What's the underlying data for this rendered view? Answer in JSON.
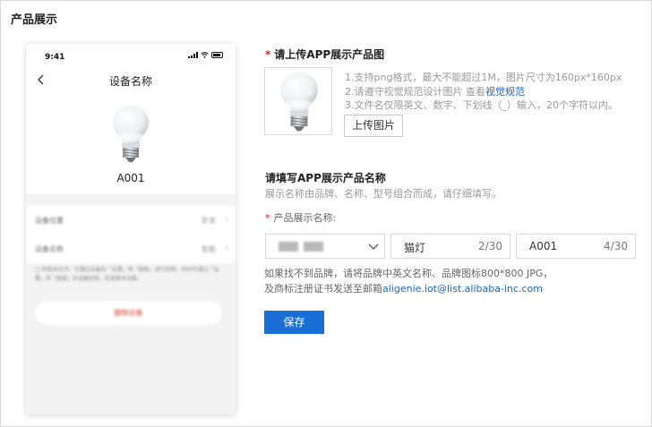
{
  "section_title": "产品展示",
  "phone": {
    "status_time": "9:41",
    "nav_title": "设备名称",
    "model": "A001",
    "blurred_rows": [
      {
        "label": "设备位置",
        "value": "卧室"
      },
      {
        "label": "设备名称",
        "value": "智能"
      }
    ],
    "blurred_text": "□ 同意协议书，可通过设备的「设置」将「智能」进行控制，同时可通过「设置」将「智能」的设备控制，实现更多功能。",
    "blurred_button": "删除设备"
  },
  "upload": {
    "required_mark": "*",
    "title": "请上传APP展示产品图",
    "hints": [
      "1.支持png格式，最大不能超过1M，图片尺寸为160px*160px",
      "2.请遵守视觉规范设计图片 查看",
      "3.文件名仅限英文、数字、下划线（_）输入，20个字符以内。"
    ],
    "hint_link": "视觉规范",
    "button": "上传图片"
  },
  "name_section": {
    "title": "请填写APP展示产品名称",
    "desc": "展示名称由品牌、名称、型号组合而成，请仔细填写。",
    "required_mark": "*",
    "field_label": "产品展示名称:",
    "name_value": "猫灯",
    "name_count": "2/30",
    "model_value": "A001",
    "model_count": "4/30"
  },
  "note": {
    "line1": "如果找不到品牌，请将品牌中英文名称、品牌图标800*800 JPG，",
    "line2": "及商标注册证书发送至邮箱",
    "email": "aligenie.iot@list.alibaba-inc.com"
  },
  "save_label": "保存"
}
